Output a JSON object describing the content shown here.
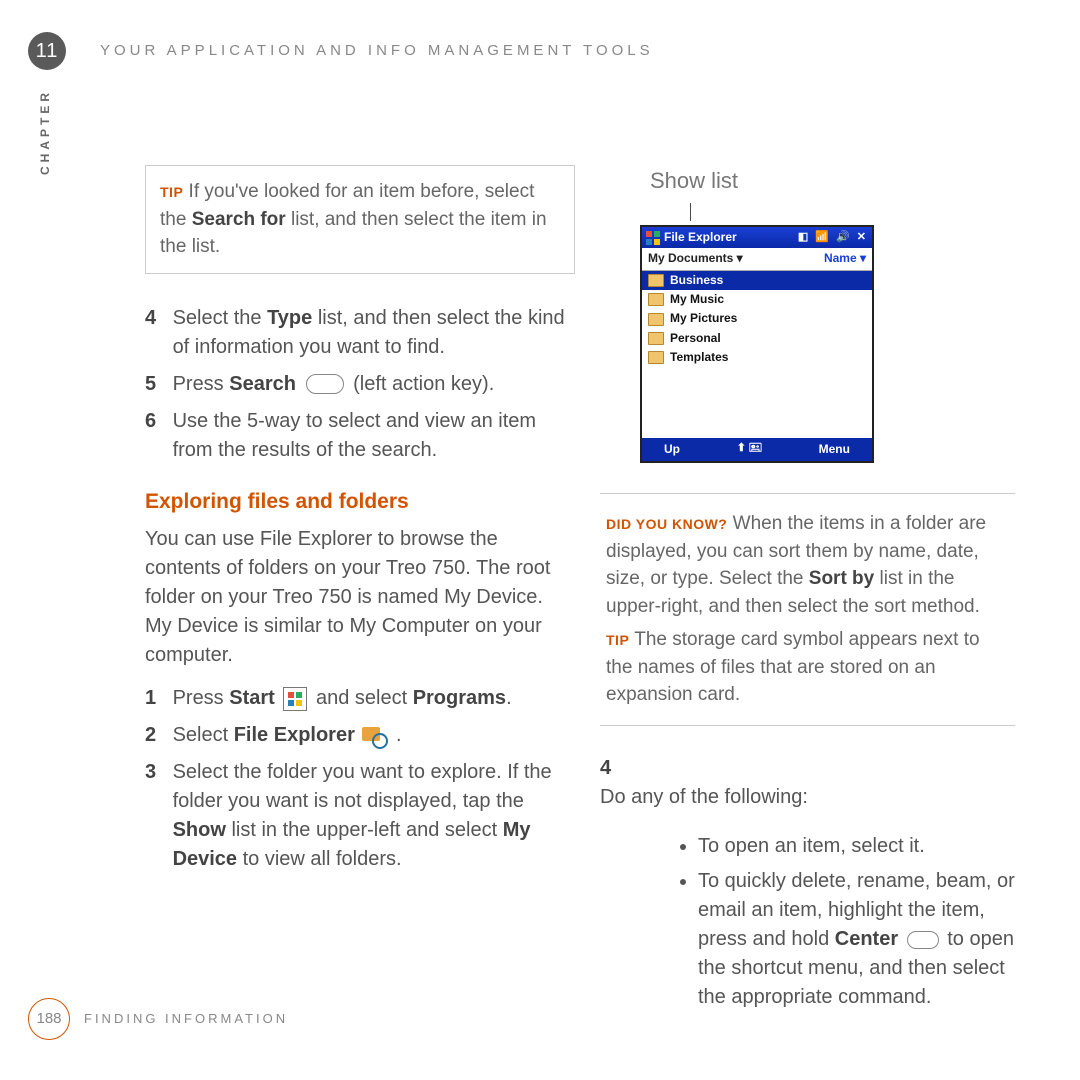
{
  "chapter": {
    "number": "11",
    "label": "CHAPTER"
  },
  "header": {
    "title": "YOUR APPLICATION AND INFO MANAGEMENT TOOLS"
  },
  "left": {
    "tip_label": "TIP",
    "tip_text": " If you've looked for an item before, select the ",
    "tip_bold": "Search for",
    "tip_tail": " list, and then select the item in the list.",
    "step4_pre": "Select the ",
    "step4_bold": "Type",
    "step4_tail": " list, and then select the kind of information you want to find.",
    "step5_pre": "Press ",
    "step5_bold": "Search",
    "step5_tail": " (left action key).",
    "step6": "Use the 5-way to select and view an item from the results of the search.",
    "heading": "Exploring files and folders",
    "intro": "You can use File Explorer to browse the contents of folders on your Treo 750. The root folder on your Treo 750 is named My Device. My Device is similar to My Computer on your computer.",
    "s1_pre": "Press ",
    "s1_b1": "Start",
    "s1_mid": " and select ",
    "s1_b2": "Programs",
    "s1_tail": ".",
    "s2_pre": "Select ",
    "s2_b": "File Explorer",
    "s2_tail": " .",
    "s3_pre": "Select the folder you want to explore. If the folder you want is not displayed, tap the ",
    "s3_b1": "Show",
    "s3_mid": " list in the upper-left and select ",
    "s3_b2": "My Device",
    "s3_tail": " to view all folders."
  },
  "right": {
    "show_label": "Show list",
    "device": {
      "title": "File Explorer",
      "path_left": "My Documents ▾",
      "path_right": "Name ▾",
      "rows": [
        "Business",
        "My Music",
        "My Pictures",
        "Personal",
        "Templates"
      ],
      "bottom_left": "Up",
      "bottom_mid": "⬆ 🖭",
      "bottom_right": "Menu"
    },
    "dyk_label": "DID YOU KNOW?",
    "dyk_text": " When the items in a folder are displayed, you can sort them by name, date, size, or type. Select the ",
    "dyk_bold": "Sort by",
    "dyk_tail": " list in the upper-right, and then select the sort method.",
    "tip2_label": "TIP",
    "tip2_text": " The storage card symbol appears next to the names of files that are stored on an expansion card.",
    "s4": "Do any of the following:",
    "b1": "To open an item, select it.",
    "b2_pre": "To quickly delete, rename, beam, or email an item, highlight the item, press and hold ",
    "b2_bold": "Center",
    "b2_tail": " to open the shortcut menu, and then select the appropriate command."
  },
  "footer": {
    "page": "188",
    "section": "FINDING INFORMATION"
  }
}
